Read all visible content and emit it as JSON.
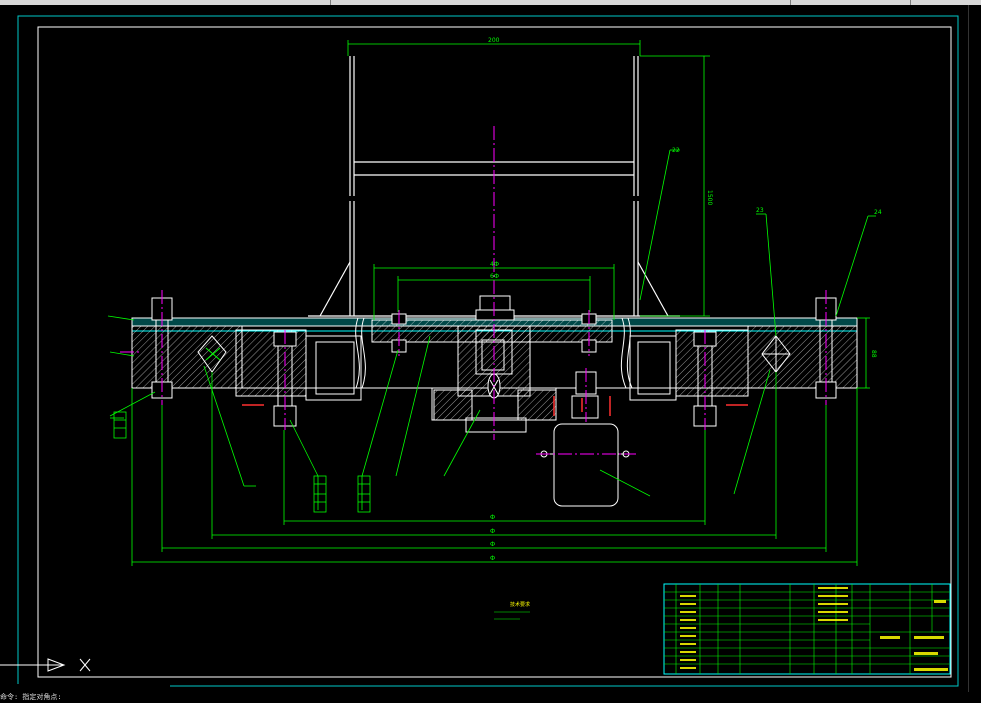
{
  "drawing": {
    "dims": {
      "top_width": "200",
      "right_height": "1500",
      "inner_span": "4Ф",
      "bolt_span": "6Ф",
      "span1": "Ф",
      "span2": "Ф",
      "span3": "Ф",
      "span4": "Ф",
      "flange_height": "88"
    },
    "balloons": {
      "b22": "22",
      "b23": "23",
      "b24": "24"
    },
    "notes_label": "技术要求",
    "cmd_text": "命令: 指定对角点:"
  },
  "colors": {
    "background": "#000000",
    "border": "#00c8c8",
    "outline": "#ffffff",
    "dimension": "#00ff00",
    "centerline": "#ff00ff",
    "hatch": "#00ffff",
    "red_marks": "#ff3030",
    "yellow_text": "#ffff00"
  }
}
